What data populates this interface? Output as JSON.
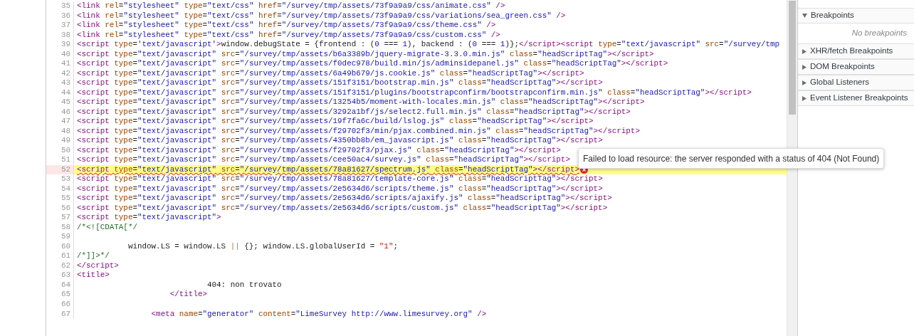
{
  "editor": {
    "lines": [
      {
        "number": "35",
        "highlighted": false,
        "segments": [
          {
            "kind": "markup",
            "text": "<link rel=\"stylesheet\" type=\"text/css\" href=\"/survey/tmp/assets/73f9a9a9/css/animate.css\" />"
          }
        ]
      },
      {
        "number": "36",
        "highlighted": false,
        "segments": [
          {
            "kind": "markup",
            "text": "<link rel=\"stylesheet\" type=\"text/css\" href=\"/survey/tmp/assets/73f9a9a9/css/variations/sea_green.css\" />"
          }
        ]
      },
      {
        "number": "37",
        "highlighted": false,
        "segments": [
          {
            "kind": "markup",
            "text": "<link rel=\"stylesheet\" type=\"text/css\" href=\"/survey/tmp/assets/73f9a9a9/css/theme.css\" />"
          }
        ]
      },
      {
        "number": "38",
        "highlighted": false,
        "segments": [
          {
            "kind": "markup",
            "text": "<link rel=\"stylesheet\" type=\"text/css\" href=\"/survey/tmp/assets/73f9a9a9/css/custom.css\" />"
          }
        ]
      },
      {
        "number": "39",
        "highlighted": false,
        "segments": [
          {
            "kind": "markup",
            "text": "<script type='text/javascript'>"
          },
          {
            "kind": "js",
            "text": "window.debugState = {frontend : (0 === 1), backend : (0 === 1)};"
          },
          {
            "kind": "markup",
            "text": "</script><script type=\"text/javascript\" src=\"/survey/tmp"
          }
        ]
      },
      {
        "number": "40",
        "highlighted": false,
        "segments": [
          {
            "kind": "markup",
            "text": "<script type=\"text/javascript\" src=\"/survey/tmp/assets/b6a3389b/jquery-migrate-3.3.0.min.js\" class=\"headScriptTag\"></script>"
          }
        ]
      },
      {
        "number": "41",
        "highlighted": false,
        "segments": [
          {
            "kind": "markup",
            "text": "<script type=\"text/javascript\" src=\"/survey/tmp/assets/f0dec978/build.min/js/adminsidepanel.js\" class=\"headScriptTag\"></script>"
          }
        ]
      },
      {
        "number": "42",
        "highlighted": false,
        "segments": [
          {
            "kind": "markup",
            "text": "<script type=\"text/javascript\" src=\"/survey/tmp/assets/6a49b679/js.cookie.js\" class=\"headScriptTag\"></script>"
          }
        ]
      },
      {
        "number": "43",
        "highlighted": false,
        "segments": [
          {
            "kind": "markup",
            "text": "<script type=\"text/javascript\" src=\"/survey/tmp/assets/151f3151/bootstrap.min.js\" class=\"headScriptTag\"></script>"
          }
        ]
      },
      {
        "number": "44",
        "highlighted": false,
        "segments": [
          {
            "kind": "markup",
            "text": "<script type=\"text/javascript\" src=\"/survey/tmp/assets/151f3151/plugins/bootstrapconfirm/bootstrapconfirm.min.js\" class=\"headScriptTag\"></script>"
          }
        ]
      },
      {
        "number": "45",
        "highlighted": false,
        "segments": [
          {
            "kind": "markup",
            "text": "<script type=\"text/javascript\" src=\"/survey/tmp/assets/13254b5/moment-with-locales.min.js\" class=\"headScriptTag\"></script>"
          }
        ]
      },
      {
        "number": "46",
        "highlighted": false,
        "segments": [
          {
            "kind": "markup",
            "text": "<script type=\"text/javascript\" src=\"/survey/tmp/assets/3292a1bf/js/select2.full.min.js\" class=\"headScriptTag\"></script>"
          }
        ]
      },
      {
        "number": "47",
        "highlighted": false,
        "segments": [
          {
            "kind": "markup",
            "text": "<script type=\"text/javascript\" src=\"/survey/tmp/assets/19f7fa6c/build/lslog.js\" class=\"headScriptTag\"></script>"
          }
        ]
      },
      {
        "number": "48",
        "highlighted": false,
        "segments": [
          {
            "kind": "markup",
            "text": "<script type=\"text/javascript\" src=\"/survey/tmp/assets/f29702f3/min/pjax.combined.min.js\" class=\"headScriptTag\"></script>"
          }
        ]
      },
      {
        "number": "49",
        "highlighted": false,
        "segments": [
          {
            "kind": "markup",
            "text": "<script type=\"text/javascript\" src=\"/survey/tmp/assets/4350bb8b/em_javascript.js\" class=\"headScriptTag\"></script>"
          }
        ]
      },
      {
        "number": "50",
        "highlighted": false,
        "segments": [
          {
            "kind": "markup",
            "text": "<script type=\"text/javascript\" src=\"/survey/tmp/assets/f29702f3/pjax.js\" class=\"headScriptTag\"></script>"
          }
        ]
      },
      {
        "number": "51",
        "highlighted": false,
        "segments": [
          {
            "kind": "markup",
            "text": "<script type=\"text/javascript\" src=\"/survey/tmp/assets/cee50ac4/survey.js\" class=\"headScriptTag\"></script>"
          }
        ]
      },
      {
        "number": "52",
        "highlighted": true,
        "segments": [
          {
            "kind": "markup",
            "text": "<script type=\"text/javascript\" src=\"/survey/tmp/assets/78a81627/spectrum.js\" class=\"headScriptTag\"></script>"
          }
        ]
      },
      {
        "number": "53",
        "highlighted": false,
        "segments": [
          {
            "kind": "markup",
            "text": "<script type=\"text/javascript\" src=\"/survey/tmp/assets/78a81627/template-core.js\" class=\"headScriptTag\"></script>"
          }
        ]
      },
      {
        "number": "54",
        "highlighted": false,
        "segments": [
          {
            "kind": "markup",
            "text": "<script type=\"text/javascript\" src=\"/survey/tmp/assets/2e5634d6/scripts/theme.js\" class=\"headScriptTag\"></script>"
          }
        ]
      },
      {
        "number": "55",
        "highlighted": false,
        "segments": [
          {
            "kind": "markup",
            "text": "<script type=\"text/javascript\" src=\"/survey/tmp/assets/2e5634d6/scripts/ajaxify.js\" class=\"headScriptTag\"></script>"
          }
        ]
      },
      {
        "number": "56",
        "highlighted": false,
        "segments": [
          {
            "kind": "markup",
            "text": "<script type=\"text/javascript\" src=\"/survey/tmp/assets/2e5634d6/scripts/custom.js\" class=\"headScriptTag\"></script>"
          }
        ]
      },
      {
        "number": "57",
        "highlighted": false,
        "segments": [
          {
            "kind": "markup",
            "text": "<script type=\"text/javascript\">"
          }
        ]
      },
      {
        "number": "58",
        "highlighted": false,
        "segments": [
          {
            "kind": "comment",
            "text": "/*<![CDATA[*/"
          }
        ]
      },
      {
        "number": "59",
        "highlighted": false
      },
      {
        "number": "60",
        "highlighted": false,
        "segments": [
          {
            "kind": "js",
            "text": "           window.LS = window.LS || {}; window.LS.globalUserId = \"1\";"
          }
        ]
      },
      {
        "number": "61",
        "highlighted": false,
        "segments": [
          {
            "kind": "comment",
            "text": "/*]]>*/"
          }
        ]
      },
      {
        "number": "62",
        "highlighted": false,
        "segments": [
          {
            "kind": "markup",
            "text": "</script>"
          }
        ]
      },
      {
        "number": "63",
        "highlighted": false,
        "segments": [
          {
            "kind": "markup",
            "text": "<title>"
          }
        ]
      },
      {
        "number": "64",
        "highlighted": false,
        "segments": [
          {
            "kind": "text",
            "text": "                            404: non trovato"
          }
        ]
      },
      {
        "number": "65",
        "highlighted": false,
        "segments": [
          {
            "kind": "markup",
            "text": "                    </title>"
          }
        ]
      },
      {
        "number": "66",
        "highlighted": false
      },
      {
        "number": "67",
        "highlighted": false,
        "segments": [
          {
            "kind": "markup",
            "text": "                <meta name=\"generator\" content=\"LimeSurvey http://www.limesurvey.org\" />"
          }
        ]
      }
    ]
  },
  "tooltip": {
    "text": "Failed to load resource: the server responded with a status of 404 (Not Found)"
  },
  "sidebar": {
    "sections": [
      {
        "title": "Breakpoints",
        "expanded": true,
        "empty_message": "No breakpoints"
      },
      {
        "title": "XHR/fetch Breakpoints",
        "expanded": false
      },
      {
        "title": "DOM Breakpoints",
        "expanded": false
      },
      {
        "title": "Global Listeners",
        "expanded": false
      },
      {
        "title": "Event Listener Breakpoints",
        "expanded": false
      }
    ]
  }
}
